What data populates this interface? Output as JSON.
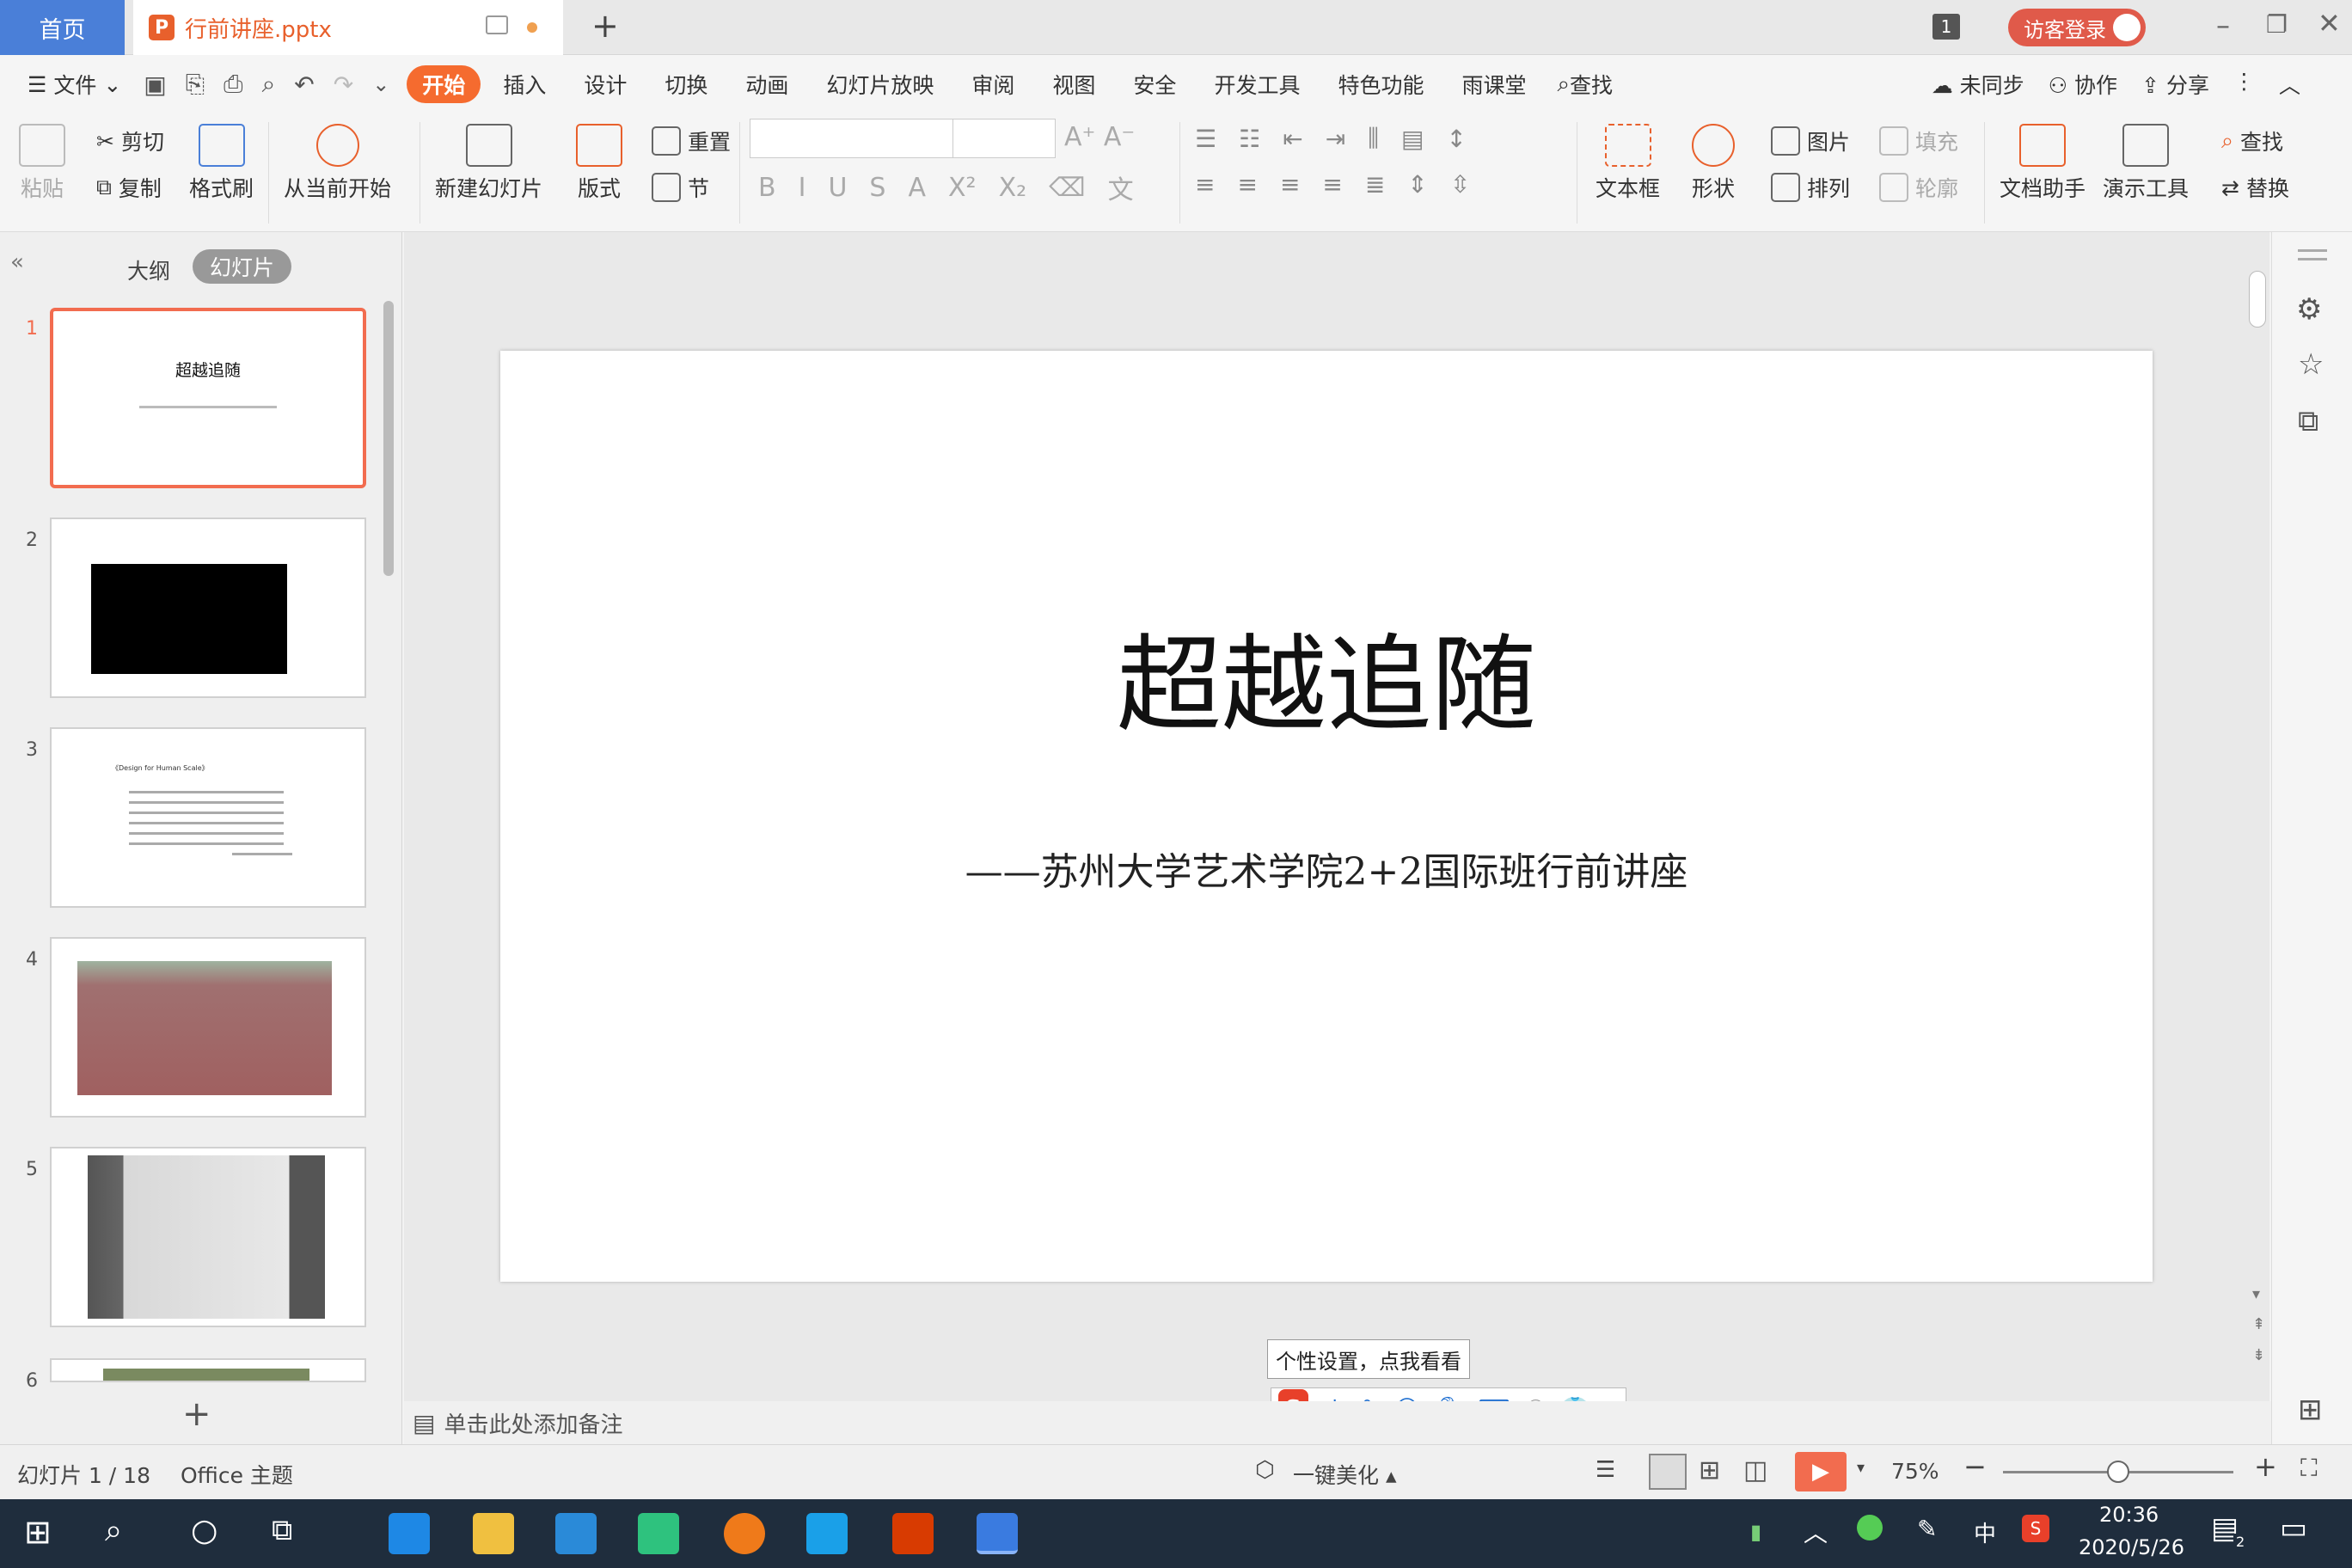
{
  "titlebar": {
    "home_tab": "首页",
    "doc_tab": "行前讲座.pptx",
    "badge": "1",
    "login": "访客登录"
  },
  "menu": {
    "file": "文件",
    "items": [
      "开始",
      "插入",
      "设计",
      "切换",
      "动画",
      "幻灯片放映",
      "审阅",
      "视图",
      "安全",
      "开发工具",
      "特色功能",
      "雨课堂"
    ],
    "search": "查找",
    "sync": "未同步",
    "collab": "协作",
    "share": "分享"
  },
  "ribbon": {
    "paste": "粘贴",
    "cut": "剪切",
    "copy": "复制",
    "format_painter": "格式刷",
    "play_current": "从当前开始",
    "new_slide": "新建幻灯片",
    "layout": "版式",
    "reset": "重置",
    "section": "节",
    "textbox": "文本框",
    "shape": "形状",
    "picture": "图片",
    "arrange": "排列",
    "fill": "填充",
    "outline": "轮廓",
    "doc_assistant": "文档助手",
    "present_tools": "演示工具",
    "find": "查找",
    "replace": "替换"
  },
  "leftpane": {
    "tab_outline": "大纲",
    "tab_slides": "幻灯片",
    "thumb1_title": "超越追随",
    "thumb3_title": "《Design for Human Scale》"
  },
  "slide": {
    "title": "超越追随",
    "subtitle": "——苏州大学艺术学院2+2国际班行前讲座"
  },
  "notes": {
    "placeholder": "单击此处添加备注"
  },
  "ime": {
    "tooltip": "个性设置，点我看看",
    "mode": "中"
  },
  "status": {
    "slide_pos": "幻灯片 1 / 18",
    "theme": "Office 主题",
    "beautify": "一键美化",
    "zoom": "75%",
    "zoom_fraction": 0.5
  },
  "taskbar": {
    "time": "20:36",
    "date": "2020/5/26",
    "ime": "中",
    "notif_count": "2"
  }
}
